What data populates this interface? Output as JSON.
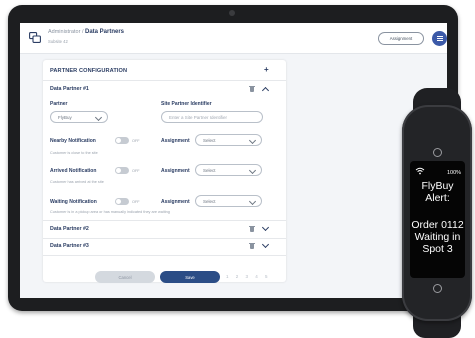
{
  "header": {
    "breadcrumb_parent": "Administrator",
    "breadcrumb_sep": "/",
    "breadcrumb_current": "Data Partners",
    "subtitle": "Subsite 42",
    "assignment_button": "Assignment"
  },
  "config": {
    "title": "PARTNER CONFIGURATION",
    "add_symbol": "+",
    "partner1": {
      "title": "Data Partner #1",
      "partner_label": "Partner",
      "partner_value": "FlyBuy",
      "site_id_label": "Site Partner Identifier",
      "site_id_placeholder": "Enter a Site Partner Identifier",
      "notifications": [
        {
          "label": "Nearby Notification",
          "toggle": "OFF",
          "assignment_label": "Assignment",
          "assignment_value": "Select",
          "helper": "Customer is close to the site"
        },
        {
          "label": "Arrived Notification",
          "toggle": "OFF",
          "assignment_label": "Assignment",
          "assignment_value": "Select",
          "helper": "Customer has arrived at the site"
        },
        {
          "label": "Waiting Notification",
          "toggle": "OFF",
          "assignment_label": "Assignment",
          "assignment_value": "Select",
          "helper": "Customer is in a pickup area or has manually indicated they are waiting"
        }
      ]
    },
    "partner2": {
      "title": "Data Partner #2"
    },
    "partner3": {
      "title": "Data Partner #3"
    }
  },
  "actions": {
    "cancel": "Cancel",
    "save": "Save",
    "pager": "1 2 3 4 5"
  },
  "band": {
    "battery": "100%",
    "alert_title": [
      "FlyBuy",
      "Alert:"
    ],
    "alert_lines": [
      "Order 0112",
      "Waiting in",
      "Spot 3"
    ]
  },
  "colors": {
    "primary": "#2b3d63",
    "accent": "#3c5aa8",
    "save": "#2b4d86"
  }
}
